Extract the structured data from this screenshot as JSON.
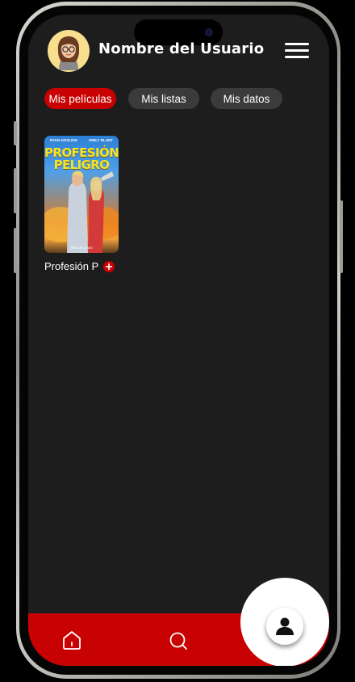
{
  "header": {
    "user_name": "Nombre del Usuario",
    "avatar_icon": "avatar-woman-glasses",
    "menu_icon": "hamburger-menu-icon"
  },
  "tabs": [
    {
      "label": "Mis películas",
      "active": true
    },
    {
      "label": "Mis listas",
      "active": false
    },
    {
      "label": "Mis datos",
      "active": false
    }
  ],
  "movies": [
    {
      "caption": "Profesión P",
      "poster_title_line1": "PROFESIÓN",
      "poster_title_line2": "PELIGRO",
      "poster_actor_left": "RYAN GOSLING",
      "poster_actor_right": "EMILY BLUNT",
      "poster_credit": "ABRIL EN CINES",
      "add_icon": "plus-icon"
    }
  ],
  "bottom_nav": {
    "items": [
      {
        "icon": "home-icon"
      },
      {
        "icon": "search-icon"
      },
      {
        "icon": "user-icon",
        "active": true
      }
    ]
  },
  "colors": {
    "accent": "#c80202",
    "background": "#1d1d1d",
    "tab_inactive": "#3b3b3b"
  }
}
